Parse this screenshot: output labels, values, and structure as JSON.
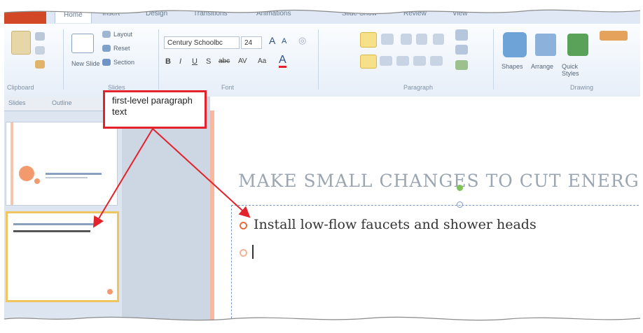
{
  "ribbon": {
    "tabs": [
      "Home",
      "Insert",
      "Design",
      "Transitions",
      "Animations",
      "Slide Show",
      "Review",
      "View"
    ],
    "slides_group": {
      "new_slide": "New Slide",
      "layout": "Layout",
      "reset": "Reset",
      "section": "Section",
      "label": "Slides"
    },
    "clipboard_label": "Clipboard",
    "font": {
      "name": "Century Schoolbc",
      "size": "24",
      "label": "Font"
    },
    "paragraph_label": "Paragraph",
    "drawing": {
      "shapes": "Shapes",
      "arrange": "Arrange",
      "quick_styles": "Quick Styles",
      "label": "Drawing"
    }
  },
  "panel": {
    "tabs": [
      "Slides",
      "Outline"
    ]
  },
  "slide": {
    "title": "MAKE SMALL CHANGES TO CUT ENERG",
    "bullet_text": "Install low-flow faucets and shower heads"
  },
  "callout": {
    "text": "first-level paragraph text"
  },
  "colors": {
    "accent": "#e46c3c",
    "callout_border": "#e2232b",
    "file_tab": "#d24726"
  }
}
